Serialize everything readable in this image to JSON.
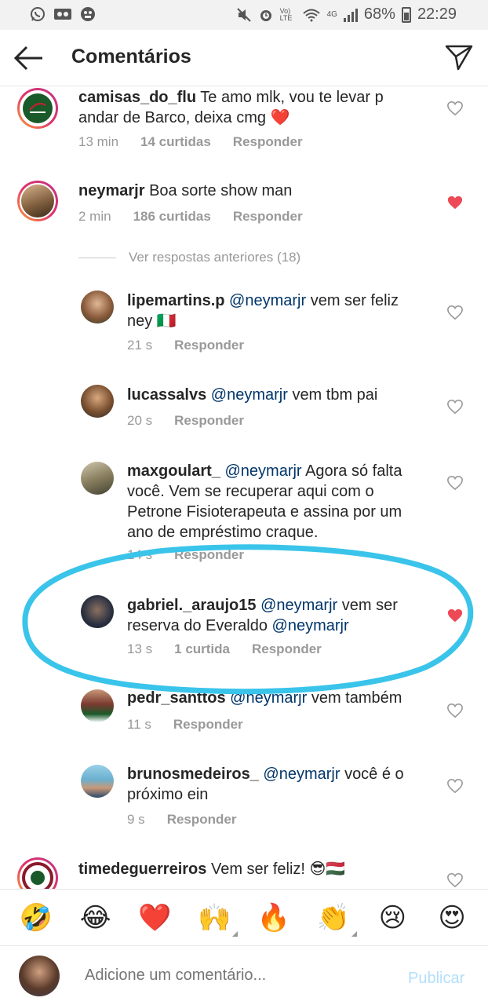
{
  "status_bar": {
    "battery": "68%",
    "time": "22:29",
    "network": "4G",
    "volte": "Vo) LTE"
  },
  "header": {
    "title": "Comentários",
    "back_icon": "arrow-left-icon",
    "send_icon": "paper-plane-icon"
  },
  "comments": [
    {
      "user": "camisas_do_flu",
      "text": "Te amo mlk, vou te levar p andar de Barco, deixa cmg ❤️",
      "time": "13 min",
      "likes": "14 curtidas",
      "reply": "Responder",
      "liked": false
    },
    {
      "user": "neymarjr",
      "text": "Boa sorte show man",
      "time": "2 min",
      "likes": "186 curtidas",
      "reply": "Responder",
      "liked": true
    }
  ],
  "replies_toggle": "Ver respostas anteriores (18)",
  "replies": [
    {
      "user": "lipemartins.p",
      "mention": "@neymarjr",
      "text": "vem ser feliz ney 🇮🇹",
      "time": "21 s",
      "reply": "Responder",
      "liked": false
    },
    {
      "user": "lucassalvs",
      "mention": "@neymarjr",
      "text": "vem tbm pai",
      "time": "20 s",
      "reply": "Responder",
      "liked": false
    },
    {
      "user": "maxgoulart_",
      "mention": "@neymarjr",
      "text": "Agora só falta você. Vem se recuperar aqui com o Petrone Fisioterapeuta e assina por um ano de empréstimo craque.",
      "time": "14 s",
      "reply": "Responder",
      "liked": false
    },
    {
      "user": "gabriel._araujo15",
      "mention": "@neymarjr",
      "text": "vem ser reserva do Everaldo",
      "mention2": "@neymarjr",
      "time": "13 s",
      "likes": "1 curtida",
      "reply": "Responder",
      "liked": true
    },
    {
      "user": "pedr_santtos",
      "mention": "@neymarjr",
      "text": "vem também",
      "time": "11 s",
      "reply": "Responder",
      "liked": false
    },
    {
      "user": "brunosmedeiros_",
      "mention": "@neymarjr",
      "text": "você é o próximo ein",
      "time": "9 s",
      "reply": "Responder",
      "liked": false
    }
  ],
  "last_comment": {
    "user": "timedeguerreiros",
    "text": "Vem ser feliz! 😎🇭🇺"
  },
  "emoji_bar": [
    "🤣",
    "😂",
    "❤️",
    "🙌",
    "🔥",
    "👏",
    "😢",
    "😍"
  ],
  "input": {
    "placeholder": "Adicione um comentário...",
    "publish": "Publicar"
  },
  "colors": {
    "like_red": "#ed4956",
    "mention_blue": "#003569",
    "annotation_cyan": "#3ac4ea",
    "publish_disabled": "#b2dffc"
  }
}
